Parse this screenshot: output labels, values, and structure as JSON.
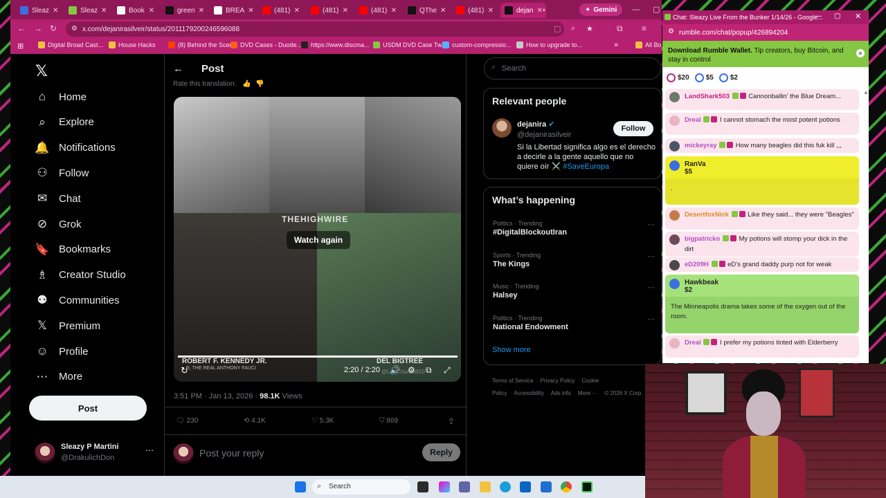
{
  "browser": {
    "tabs": [
      {
        "label": "Sleaz",
        "color": "#3b6fe0"
      },
      {
        "label": "Sleaz",
        "color": "#85c742"
      },
      {
        "label": "Book",
        "color": "#f5f5f5"
      },
      {
        "label": "green",
        "color": "#111111"
      },
      {
        "label": "BREA",
        "color": "#ffffff"
      },
      {
        "label": "(481)",
        "color": "#ff0000"
      },
      {
        "label": "(481)",
        "color": "#ff0000"
      },
      {
        "label": "(481)",
        "color": "#ff0000"
      },
      {
        "label": "QThe",
        "color": "#111111"
      },
      {
        "label": "(481)",
        "color": "#ff0000"
      },
      {
        "label": "dejan",
        "color": "#111111"
      }
    ],
    "gemini_label": "Gemini",
    "url": "x.com/dejanirasilveir/status/2011179200246596088",
    "bookmarks": [
      "Digital Broad Cast...",
      "House Hacks",
      "(8) Behind the Scen...",
      "DVD Cases - Duode...",
      "https://www.discma...",
      "USDM DVD Case Tw...",
      "custom-compressio...",
      "How to upgrade to..."
    ],
    "bookmarks_overflow": "All Bo"
  },
  "x": {
    "nav": [
      {
        "label": "Home",
        "icon": "home-icon",
        "glyph": "⌂"
      },
      {
        "label": "Explore",
        "icon": "search-icon",
        "glyph": "⌕"
      },
      {
        "label": "Notifications",
        "icon": "bell-icon",
        "glyph": "🔔"
      },
      {
        "label": "Follow",
        "icon": "follow-icon",
        "glyph": "⚇"
      },
      {
        "label": "Chat",
        "icon": "mail-icon",
        "glyph": "✉"
      },
      {
        "label": "Grok",
        "icon": "grok-icon",
        "glyph": "⊘"
      },
      {
        "label": "Bookmarks",
        "icon": "bookmark-icon",
        "glyph": "🔖"
      },
      {
        "label": "Creator Studio",
        "icon": "creator-icon",
        "glyph": "♗"
      },
      {
        "label": "Communities",
        "icon": "communities-icon",
        "glyph": "⚉"
      },
      {
        "label": "Premium",
        "icon": "x-logo-icon",
        "glyph": "𝕏"
      },
      {
        "label": "Profile",
        "icon": "profile-icon",
        "glyph": "☺"
      },
      {
        "label": "More",
        "icon": "more-icon",
        "glyph": "⋯"
      }
    ],
    "post_button": "Post",
    "me": {
      "name": "Sleazy P Martini",
      "handle": "@DrakulichDon"
    },
    "header_title": "Post",
    "rate_translation": "Rate this translation:",
    "video": {
      "watch_again": "Watch again",
      "lower_left": "ROBERT F. KENNEDY JR.",
      "lower_left_sub": "...R, THE REAL ANTHONY FAUCI",
      "lower_right": "DEL BIGTREE",
      "overlay": "THEHIGHWIRE",
      "watermark": "@Liz_Churchill10",
      "time": "2:20 / 2:20",
      "progress": 1.0
    },
    "meta": {
      "time": "3:51 PM · Jan 13, 2026 · ",
      "views": "98.1K",
      "views_label": " Views"
    },
    "actions": {
      "replies": "230",
      "reposts": "4.1K",
      "likes": "5.3K",
      "bookmarks": "869"
    },
    "reply_placeholder": "Post your reply",
    "reply_button": "Reply",
    "search_placeholder": "Search",
    "relevant": {
      "title": "Relevant people",
      "name": "dejanira",
      "handle": "@dejanirasilveir",
      "follow": "Follow",
      "bio": "Si la Libertad significa algo es el derecho a decirle a la gente aquello que no quiere oír ⚔️",
      "hashtag": "#SaveEuropa"
    },
    "happening": {
      "title": "What’s happening",
      "trends": [
        {
          "category": "Politics · Trending",
          "name": "#DigitalBlockoutIran"
        },
        {
          "category": "Sports · Trending",
          "name": "The Kings"
        },
        {
          "category": "Music · Trending",
          "name": "Halsey"
        },
        {
          "category": "Politics · Trending",
          "name": "National Endowment"
        }
      ],
      "show_more": "Show more"
    },
    "footer": [
      "Terms of Service",
      "Privacy Policy",
      "Cookie Policy",
      "Accessibility",
      "Ads info",
      "More ···",
      "© 2026 X Corp."
    ]
  },
  "rumble": {
    "window_title": "Chat: Sleazy Live From the Bunker 1/14/26 - Google...",
    "url": "rumble.com/chat/popup/426894204",
    "wallet_bold": "Download Rumble Wallet.",
    "wallet_text": " Tip creators, buy Bitcoin, and stay in control",
    "rant_chips": [
      "$20",
      "$5",
      "$2"
    ],
    "messages": [
      {
        "user": "LandShark503",
        "text": "Cannonballin' the Blue Dream...",
        "color": "#c0247e"
      },
      {
        "user": "Dreal",
        "text": "I cannot stomach the most potent potions",
        "color": "#b34fc8"
      },
      {
        "user": "mickeyray",
        "text": "How many beagles did this fuk kill ,,,",
        "color": "#b34fc8"
      },
      {
        "user": "DesertfoxNick",
        "text": "Like they said... they were \"Beagles\"",
        "color": "#e08a22"
      },
      {
        "user": "bigpatricko",
        "text": "My potions will stomp your dick in the dirt",
        "color": "#b34fc8"
      },
      {
        "user": "eD209H",
        "text": "eD's grand daddy purp not for weak",
        "color": "#b34fc8"
      },
      {
        "user": "Dreal",
        "text": "I prefer my potions tinted with Elderberry",
        "color": "#b34fc8"
      }
    ],
    "rants": [
      {
        "user": "RanVa",
        "amount": "$5",
        "text": ".",
        "bg": "#f0ee2a",
        "body_bg": "#e5e32c"
      },
      {
        "user": "Hawkbeak",
        "amount": "$2",
        "text": "The Minneapolis drama takes some of the oxygen out of the room.",
        "bg": "#a5e27a",
        "body_bg": "#95d46a"
      }
    ]
  },
  "taskbar": {
    "search_placeholder": "Search"
  }
}
